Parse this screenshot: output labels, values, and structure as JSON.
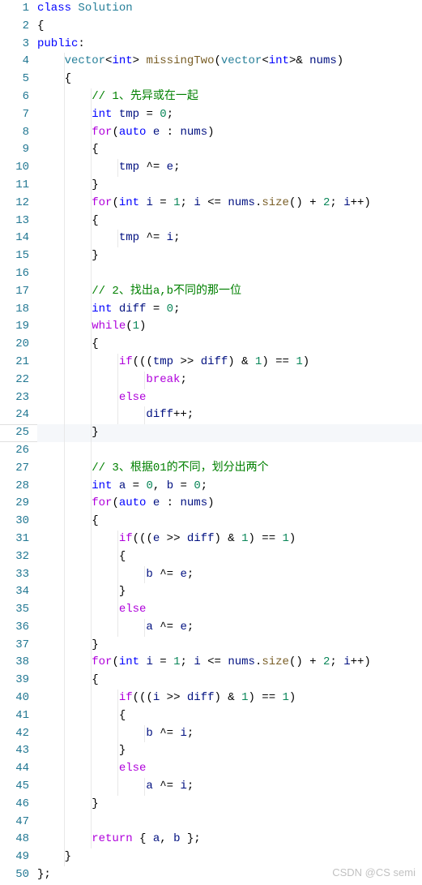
{
  "watermark": "CSDN @CS semi",
  "highlightLine": 25,
  "lines": [
    [
      {
        "c": "k",
        "t": "class"
      },
      {
        "c": "p",
        "t": " "
      },
      {
        "c": "t",
        "t": "Solution"
      }
    ],
    [
      {
        "c": "p",
        "t": "{"
      }
    ],
    [
      {
        "c": "k",
        "t": "public"
      },
      {
        "c": "p",
        "t": ":"
      }
    ],
    [
      {
        "c": "p",
        "t": "    "
      },
      {
        "c": "t",
        "t": "vector"
      },
      {
        "c": "p",
        "t": "<"
      },
      {
        "c": "k",
        "t": "int"
      },
      {
        "c": "p",
        "t": "> "
      },
      {
        "c": "fn",
        "t": "missingTwo"
      },
      {
        "c": "p",
        "t": "("
      },
      {
        "c": "t",
        "t": "vector"
      },
      {
        "c": "p",
        "t": "<"
      },
      {
        "c": "k",
        "t": "int"
      },
      {
        "c": "p",
        "t": ">& "
      },
      {
        "c": "v",
        "t": "nums"
      },
      {
        "c": "p",
        "t": ")"
      }
    ],
    [
      {
        "c": "p",
        "t": "    {"
      }
    ],
    [
      {
        "c": "p",
        "t": "        "
      },
      {
        "c": "c",
        "t": "// 1、先异或在一起"
      }
    ],
    [
      {
        "c": "p",
        "t": "        "
      },
      {
        "c": "k",
        "t": "int"
      },
      {
        "c": "p",
        "t": " "
      },
      {
        "c": "v",
        "t": "tmp"
      },
      {
        "c": "p",
        "t": " = "
      },
      {
        "c": "n",
        "t": "0"
      },
      {
        "c": "p",
        "t": ";"
      }
    ],
    [
      {
        "c": "p",
        "t": "        "
      },
      {
        "c": "kw2",
        "t": "for"
      },
      {
        "c": "p",
        "t": "("
      },
      {
        "c": "k",
        "t": "auto"
      },
      {
        "c": "p",
        "t": " "
      },
      {
        "c": "v",
        "t": "e"
      },
      {
        "c": "p",
        "t": " : "
      },
      {
        "c": "v",
        "t": "nums"
      },
      {
        "c": "p",
        "t": ")"
      }
    ],
    [
      {
        "c": "p",
        "t": "        {"
      }
    ],
    [
      {
        "c": "p",
        "t": "            "
      },
      {
        "c": "v",
        "t": "tmp"
      },
      {
        "c": "p",
        "t": " ^= "
      },
      {
        "c": "v",
        "t": "e"
      },
      {
        "c": "p",
        "t": ";"
      }
    ],
    [
      {
        "c": "p",
        "t": "        }"
      }
    ],
    [
      {
        "c": "p",
        "t": "        "
      },
      {
        "c": "kw2",
        "t": "for"
      },
      {
        "c": "p",
        "t": "("
      },
      {
        "c": "k",
        "t": "int"
      },
      {
        "c": "p",
        "t": " "
      },
      {
        "c": "v",
        "t": "i"
      },
      {
        "c": "p",
        "t": " = "
      },
      {
        "c": "n",
        "t": "1"
      },
      {
        "c": "p",
        "t": "; "
      },
      {
        "c": "v",
        "t": "i"
      },
      {
        "c": "p",
        "t": " <= "
      },
      {
        "c": "v",
        "t": "nums"
      },
      {
        "c": "p",
        "t": "."
      },
      {
        "c": "fn",
        "t": "size"
      },
      {
        "c": "p",
        "t": "() + "
      },
      {
        "c": "n",
        "t": "2"
      },
      {
        "c": "p",
        "t": "; "
      },
      {
        "c": "v",
        "t": "i"
      },
      {
        "c": "p",
        "t": "++)"
      }
    ],
    [
      {
        "c": "p",
        "t": "        {"
      }
    ],
    [
      {
        "c": "p",
        "t": "            "
      },
      {
        "c": "v",
        "t": "tmp"
      },
      {
        "c": "p",
        "t": " ^= "
      },
      {
        "c": "v",
        "t": "i"
      },
      {
        "c": "p",
        "t": ";"
      }
    ],
    [
      {
        "c": "p",
        "t": "        }"
      }
    ],
    [
      {
        "c": "p",
        "t": ""
      }
    ],
    [
      {
        "c": "p",
        "t": "        "
      },
      {
        "c": "c",
        "t": "// 2、找出a,b不同的那一位"
      }
    ],
    [
      {
        "c": "p",
        "t": "        "
      },
      {
        "c": "k",
        "t": "int"
      },
      {
        "c": "p",
        "t": " "
      },
      {
        "c": "v",
        "t": "diff"
      },
      {
        "c": "p",
        "t": " = "
      },
      {
        "c": "n",
        "t": "0"
      },
      {
        "c": "p",
        "t": ";"
      }
    ],
    [
      {
        "c": "p",
        "t": "        "
      },
      {
        "c": "kw2",
        "t": "while"
      },
      {
        "c": "p",
        "t": "("
      },
      {
        "c": "n",
        "t": "1"
      },
      {
        "c": "p",
        "t": ")"
      }
    ],
    [
      {
        "c": "p",
        "t": "        {"
      }
    ],
    [
      {
        "c": "p",
        "t": "            "
      },
      {
        "c": "kw2",
        "t": "if"
      },
      {
        "c": "p",
        "t": "((("
      },
      {
        "c": "v",
        "t": "tmp"
      },
      {
        "c": "p",
        "t": " >> "
      },
      {
        "c": "v",
        "t": "diff"
      },
      {
        "c": "p",
        "t": ") & "
      },
      {
        "c": "n",
        "t": "1"
      },
      {
        "c": "p",
        "t": ") == "
      },
      {
        "c": "n",
        "t": "1"
      },
      {
        "c": "p",
        "t": ")"
      }
    ],
    [
      {
        "c": "p",
        "t": "                "
      },
      {
        "c": "kw2",
        "t": "break"
      },
      {
        "c": "p",
        "t": ";"
      }
    ],
    [
      {
        "c": "p",
        "t": "            "
      },
      {
        "c": "kw2",
        "t": "else"
      }
    ],
    [
      {
        "c": "p",
        "t": "                "
      },
      {
        "c": "v",
        "t": "diff"
      },
      {
        "c": "p",
        "t": "++;"
      }
    ],
    [
      {
        "c": "p",
        "t": "        }"
      }
    ],
    [
      {
        "c": "p",
        "t": ""
      }
    ],
    [
      {
        "c": "p",
        "t": "        "
      },
      {
        "c": "c",
        "t": "// 3、根据01的不同，划分出两个"
      }
    ],
    [
      {
        "c": "p",
        "t": "        "
      },
      {
        "c": "k",
        "t": "int"
      },
      {
        "c": "p",
        "t": " "
      },
      {
        "c": "v",
        "t": "a"
      },
      {
        "c": "p",
        "t": " = "
      },
      {
        "c": "n",
        "t": "0"
      },
      {
        "c": "p",
        "t": ", "
      },
      {
        "c": "v",
        "t": "b"
      },
      {
        "c": "p",
        "t": " = "
      },
      {
        "c": "n",
        "t": "0"
      },
      {
        "c": "p",
        "t": ";"
      }
    ],
    [
      {
        "c": "p",
        "t": "        "
      },
      {
        "c": "kw2",
        "t": "for"
      },
      {
        "c": "p",
        "t": "("
      },
      {
        "c": "k",
        "t": "auto"
      },
      {
        "c": "p",
        "t": " "
      },
      {
        "c": "v",
        "t": "e"
      },
      {
        "c": "p",
        "t": " : "
      },
      {
        "c": "v",
        "t": "nums"
      },
      {
        "c": "p",
        "t": ")"
      }
    ],
    [
      {
        "c": "p",
        "t": "        {"
      }
    ],
    [
      {
        "c": "p",
        "t": "            "
      },
      {
        "c": "kw2",
        "t": "if"
      },
      {
        "c": "p",
        "t": "((("
      },
      {
        "c": "v",
        "t": "e"
      },
      {
        "c": "p",
        "t": " >> "
      },
      {
        "c": "v",
        "t": "diff"
      },
      {
        "c": "p",
        "t": ") & "
      },
      {
        "c": "n",
        "t": "1"
      },
      {
        "c": "p",
        "t": ") == "
      },
      {
        "c": "n",
        "t": "1"
      },
      {
        "c": "p",
        "t": ")"
      }
    ],
    [
      {
        "c": "p",
        "t": "            {"
      }
    ],
    [
      {
        "c": "p",
        "t": "                "
      },
      {
        "c": "v",
        "t": "b"
      },
      {
        "c": "p",
        "t": " ^= "
      },
      {
        "c": "v",
        "t": "e"
      },
      {
        "c": "p",
        "t": ";"
      }
    ],
    [
      {
        "c": "p",
        "t": "            }"
      }
    ],
    [
      {
        "c": "p",
        "t": "            "
      },
      {
        "c": "kw2",
        "t": "else"
      }
    ],
    [
      {
        "c": "p",
        "t": "                "
      },
      {
        "c": "v",
        "t": "a"
      },
      {
        "c": "p",
        "t": " ^= "
      },
      {
        "c": "v",
        "t": "e"
      },
      {
        "c": "p",
        "t": ";"
      }
    ],
    [
      {
        "c": "p",
        "t": "        }"
      }
    ],
    [
      {
        "c": "p",
        "t": "        "
      },
      {
        "c": "kw2",
        "t": "for"
      },
      {
        "c": "p",
        "t": "("
      },
      {
        "c": "k",
        "t": "int"
      },
      {
        "c": "p",
        "t": " "
      },
      {
        "c": "v",
        "t": "i"
      },
      {
        "c": "p",
        "t": " = "
      },
      {
        "c": "n",
        "t": "1"
      },
      {
        "c": "p",
        "t": "; "
      },
      {
        "c": "v",
        "t": "i"
      },
      {
        "c": "p",
        "t": " <= "
      },
      {
        "c": "v",
        "t": "nums"
      },
      {
        "c": "p",
        "t": "."
      },
      {
        "c": "fn",
        "t": "size"
      },
      {
        "c": "p",
        "t": "() + "
      },
      {
        "c": "n",
        "t": "2"
      },
      {
        "c": "p",
        "t": "; "
      },
      {
        "c": "v",
        "t": "i"
      },
      {
        "c": "p",
        "t": "++)"
      }
    ],
    [
      {
        "c": "p",
        "t": "        {"
      }
    ],
    [
      {
        "c": "p",
        "t": "            "
      },
      {
        "c": "kw2",
        "t": "if"
      },
      {
        "c": "p",
        "t": "((("
      },
      {
        "c": "v",
        "t": "i"
      },
      {
        "c": "p",
        "t": " >> "
      },
      {
        "c": "v",
        "t": "diff"
      },
      {
        "c": "p",
        "t": ") & "
      },
      {
        "c": "n",
        "t": "1"
      },
      {
        "c": "p",
        "t": ") == "
      },
      {
        "c": "n",
        "t": "1"
      },
      {
        "c": "p",
        "t": ")"
      }
    ],
    [
      {
        "c": "p",
        "t": "            {"
      }
    ],
    [
      {
        "c": "p",
        "t": "                "
      },
      {
        "c": "v",
        "t": "b"
      },
      {
        "c": "p",
        "t": " ^= "
      },
      {
        "c": "v",
        "t": "i"
      },
      {
        "c": "p",
        "t": ";"
      }
    ],
    [
      {
        "c": "p",
        "t": "            }"
      }
    ],
    [
      {
        "c": "p",
        "t": "            "
      },
      {
        "c": "kw2",
        "t": "else"
      }
    ],
    [
      {
        "c": "p",
        "t": "                "
      },
      {
        "c": "v",
        "t": "a"
      },
      {
        "c": "p",
        "t": " ^= "
      },
      {
        "c": "v",
        "t": "i"
      },
      {
        "c": "p",
        "t": ";"
      }
    ],
    [
      {
        "c": "p",
        "t": "        }"
      }
    ],
    [
      {
        "c": "p",
        "t": ""
      }
    ],
    [
      {
        "c": "p",
        "t": "        "
      },
      {
        "c": "kw2",
        "t": "return"
      },
      {
        "c": "p",
        "t": " { "
      },
      {
        "c": "v",
        "t": "a"
      },
      {
        "c": "p",
        "t": ", "
      },
      {
        "c": "v",
        "t": "b"
      },
      {
        "c": "p",
        "t": " };"
      }
    ],
    [
      {
        "c": "p",
        "t": "    }"
      }
    ],
    [
      {
        "c": "p",
        "t": "};"
      }
    ]
  ],
  "guides": [
    [],
    [],
    [],
    [
      1
    ],
    [
      1
    ],
    [
      1,
      2
    ],
    [
      1,
      2
    ],
    [
      1,
      2
    ],
    [
      1,
      2
    ],
    [
      1,
      2,
      3
    ],
    [
      1,
      2
    ],
    [
      1,
      2
    ],
    [
      1,
      2
    ],
    [
      1,
      2,
      3
    ],
    [
      1,
      2
    ],
    [
      1,
      2
    ],
    [
      1,
      2
    ],
    [
      1,
      2
    ],
    [
      1,
      2
    ],
    [
      1,
      2
    ],
    [
      1,
      2,
      3
    ],
    [
      1,
      2,
      3,
      4
    ],
    [
      1,
      2,
      3
    ],
    [
      1,
      2,
      3,
      4
    ],
    [
      1,
      2
    ],
    [
      1,
      2
    ],
    [
      1,
      2
    ],
    [
      1,
      2
    ],
    [
      1,
      2
    ],
    [
      1,
      2
    ],
    [
      1,
      2,
      3
    ],
    [
      1,
      2,
      3
    ],
    [
      1,
      2,
      3,
      4
    ],
    [
      1,
      2,
      3
    ],
    [
      1,
      2,
      3
    ],
    [
      1,
      2,
      3,
      4
    ],
    [
      1,
      2
    ],
    [
      1,
      2
    ],
    [
      1,
      2
    ],
    [
      1,
      2,
      3
    ],
    [
      1,
      2,
      3
    ],
    [
      1,
      2,
      3,
      4
    ],
    [
      1,
      2,
      3
    ],
    [
      1,
      2,
      3
    ],
    [
      1,
      2,
      3,
      4
    ],
    [
      1,
      2
    ],
    [
      1,
      2
    ],
    [
      1,
      2
    ],
    [
      1
    ],
    []
  ]
}
